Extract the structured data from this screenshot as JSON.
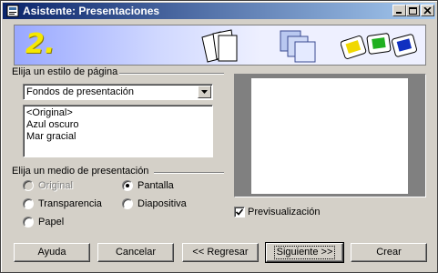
{
  "window": {
    "title": "Asistente: Presentaciones"
  },
  "banner": {
    "step": "2."
  },
  "page_style": {
    "label": "Elija un estilo de página",
    "dropdown_value": "Fondos de presentación",
    "list": [
      "<Original>",
      "Azul oscuro",
      "Mar gracial"
    ]
  },
  "medium": {
    "label": "Elija un medio de presentación",
    "options": {
      "original": "Original",
      "transparencia": "Transparencia",
      "papel": "Papel",
      "pantalla": "Pantalla",
      "diapositiva": "Diapositiva"
    },
    "selected": "Pantalla"
  },
  "preview": {
    "checkbox_label": "Previsualización",
    "checked": true
  },
  "buttons": {
    "help": "Ayuda",
    "cancel": "Cancelar",
    "back": "<< Regresar",
    "next": "Siguiente >>",
    "create": "Crear"
  }
}
